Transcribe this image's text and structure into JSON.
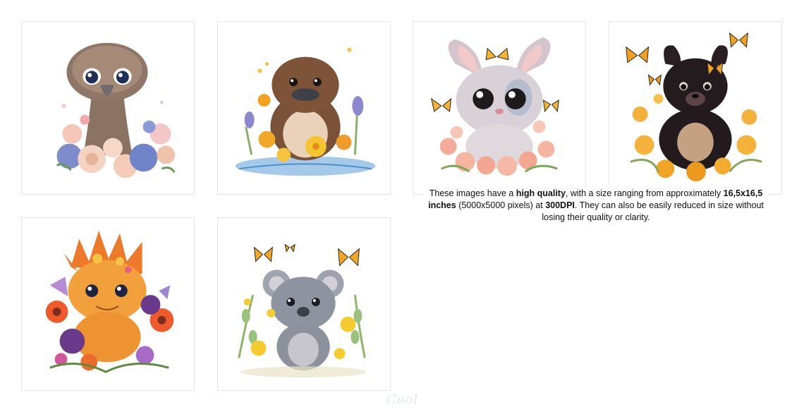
{
  "gallery": {
    "items": [
      {
        "subject": "emu-chick-with-flowers"
      },
      {
        "subject": "platypus-in-pond"
      },
      {
        "subject": "bilby-with-butterflies"
      },
      {
        "subject": "tasmanian-devil-with-butterflies"
      },
      {
        "subject": "thorny-dragon-with-flowers"
      },
      {
        "subject": "koala-with-butterflies"
      }
    ]
  },
  "caption": {
    "t1": "These images have a ",
    "b1": "high quality",
    "t2": ", with a size ranging from approximately ",
    "b2": "16,5x16,5 inches",
    "t3": " (5000x5000 pixels) at ",
    "b3": "300DPI",
    "t4": ". They can also be easily reduced in size without losing their quality or clarity."
  },
  "watermark": "Cool",
  "colors": {
    "card_border": "#e6e6e6",
    "caption_text": "#111111",
    "watermark": "#e4e9ef"
  }
}
